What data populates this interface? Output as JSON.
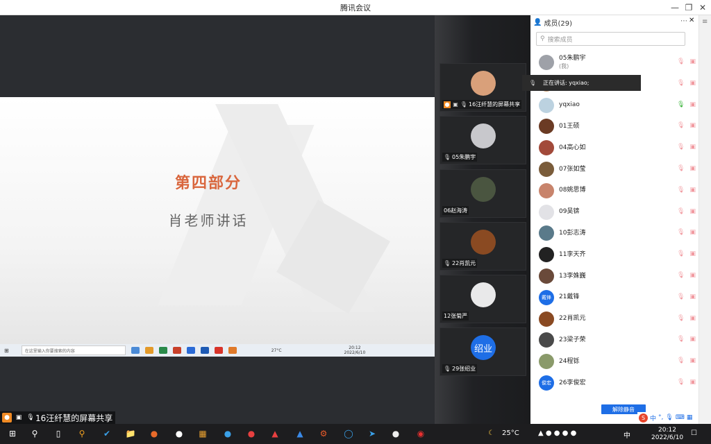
{
  "window": {
    "title": "腾讯会议"
  },
  "slide": {
    "title": "第四部分",
    "subtitle": "肖老师讲话"
  },
  "mini_taskbar": {
    "search_placeholder": "在这里输入你要搜索的内容",
    "weather": "27°C",
    "time": "20:12",
    "date": "2022/6/10"
  },
  "share": {
    "label": "16汪纤慧的屏幕共享"
  },
  "tiles": [
    {
      "name": "16汪纤慧的屏幕共享",
      "avatar_color": "#d9a07a"
    },
    {
      "name": "05朱鹏宇",
      "avatar_color": "#c8c8cc"
    },
    {
      "name": "06赵海涛",
      "avatar_color": "#4a5540"
    },
    {
      "name": "22肖凯元",
      "avatar_color": "#8a4a22"
    },
    {
      "name": "12张菊严",
      "avatar_color": "#e9e9ea"
    },
    {
      "name": "29张绍业",
      "avatar_color": "#1e6ee6",
      "avatar_text": "绍业"
    }
  ],
  "panel": {
    "title": "成员(29)",
    "search_placeholder": "搜索成员",
    "unmute_label": "解除静音",
    "tooltip": "正在讲话: yqxiao;",
    "members": [
      {
        "name": "05朱鹏宇",
        "note": "(我)",
        "color": "#9ea1a8",
        "mic": "off"
      },
      {
        "name": "",
        "note": "",
        "color": "#c99a6e",
        "mic": "off"
      },
      {
        "name": "yqxiao",
        "note": "",
        "color": "#bcd2e0",
        "mic": "on"
      },
      {
        "name": "01王硕",
        "note": "",
        "color": "#6b3b24",
        "mic": "off"
      },
      {
        "name": "04高心如",
        "note": "",
        "color": "#a24a3a",
        "mic": "off"
      },
      {
        "name": "07张如莹",
        "note": "",
        "color": "#7a5c3a",
        "mic": "off"
      },
      {
        "name": "08姚思博",
        "note": "",
        "color": "#c8846c",
        "mic": "off"
      },
      {
        "name": "09吴锛",
        "note": "",
        "color": "#e2e2e6",
        "mic": "off"
      },
      {
        "name": "10彭志涛",
        "note": "",
        "color": "#5a7a8a",
        "mic": "off"
      },
      {
        "name": "11李天齐",
        "note": "",
        "color": "#222222",
        "mic": "off"
      },
      {
        "name": "13李姝巍",
        "note": "",
        "color": "#6a4a3a",
        "mic": "off"
      },
      {
        "name": "21戴锋",
        "note": "",
        "color": "#1e6ee6",
        "avatar_text": "戴锋",
        "mic": "off"
      },
      {
        "name": "22肖凯元",
        "note": "",
        "color": "#8a4a22",
        "mic": "off"
      },
      {
        "name": "23梁子荣",
        "note": "",
        "color": "#4a4a4a",
        "mic": "off"
      },
      {
        "name": "24程铄",
        "note": "",
        "color": "#8a9a6a",
        "mic": "off"
      },
      {
        "name": "26李俊宏",
        "note": "",
        "color": "#1e6ee6",
        "avatar_text": "俊宏",
        "mic": "off"
      }
    ]
  },
  "taskbar": {
    "weather": "25°C",
    "ime": "中",
    "time": "20:12",
    "date": "2022/6/10"
  }
}
